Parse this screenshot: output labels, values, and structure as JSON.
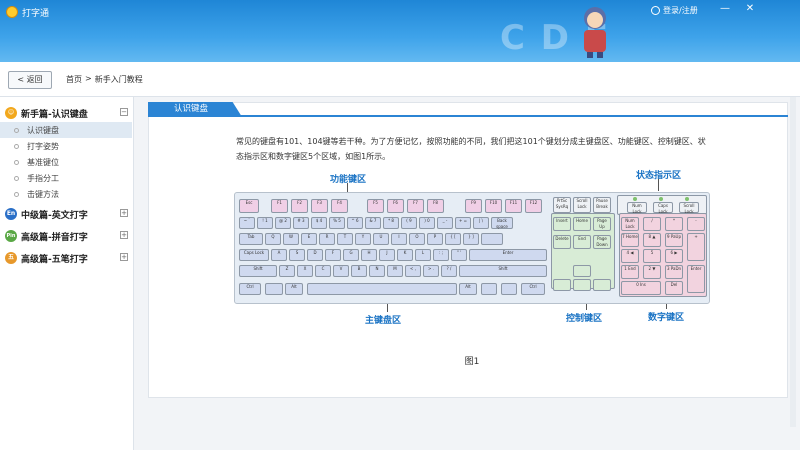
{
  "app": {
    "title": "打字通",
    "login": "登录/注册"
  },
  "window": {
    "minimize": "—",
    "close": "✕"
  },
  "nav": {
    "back": "< 返回",
    "breadcrumb": [
      "首页",
      ">",
      "新手入门教程"
    ]
  },
  "sidebar": {
    "groups": [
      {
        "label": "新手篇-认识键盘",
        "icon": "smiley-icon",
        "color": "#f2a81d",
        "toggle": "−",
        "items": [
          {
            "label": "认识键盘",
            "active": true
          },
          {
            "label": "打字姿势",
            "active": false
          },
          {
            "label": "基准键位",
            "active": false
          },
          {
            "label": "手指分工",
            "active": false
          },
          {
            "label": "击键方法",
            "active": false
          }
        ]
      },
      {
        "label": "中级篇-英文打字",
        "icon": "En",
        "color": "#2a6fc7",
        "toggle": "+"
      },
      {
        "label": "高级篇-拼音打字",
        "icon": "Pin",
        "color": "#5aa845",
        "toggle": "+"
      },
      {
        "label": "高级篇-五笔打字",
        "icon": "五",
        "color": "#e7982b",
        "toggle": "+"
      }
    ]
  },
  "content": {
    "tab_title": "认识键盘",
    "paragraph": "常见的键盘有101、104键等若干种。为了方便记忆，按照功能的不同，我们把这101个键划分成主键盘区、功能键区、控制键区、状态指示区和数字键区5个区域，如图1所示。",
    "callouts": {
      "function": "功能键区",
      "status": "状态指示区",
      "main": "主键盘区",
      "control": "控制键区",
      "numpad": "数字键区"
    },
    "figure_caption": "图1"
  },
  "keyboard": {
    "fn_row": [
      "Esc",
      "F1",
      "F2",
      "F3",
      "F4",
      "F5",
      "F6",
      "F7",
      "F8",
      "F9",
      "F10",
      "F11",
      "F12"
    ],
    "sys_row": [
      "PrtSc SysRq",
      "Scroll Lock",
      "Pause Break"
    ],
    "status_lights": [
      "Num Lock",
      "Caps Lock",
      "Scroll Lock"
    ],
    "num_row": [
      "~ `",
      "! 1",
      "@ 2",
      "# 3",
      "$ 4",
      "% 5",
      "^ 6",
      "& 7",
      "* 8",
      "( 9",
      ") 0",
      "_ -",
      "+ =",
      "| \\",
      "Back space"
    ],
    "tab_row": [
      "Tab",
      "Q",
      "W",
      "E",
      "R",
      "T",
      "Y",
      "U",
      "I",
      "O",
      "P",
      "{ [",
      "} ]"
    ],
    "caps_row": [
      "Caps Lock",
      "A",
      "S",
      "D",
      "F",
      "G",
      "H",
      "J",
      "K",
      "L",
      ": ;",
      "\" '",
      "Enter"
    ],
    "shift_row": [
      "Shift",
      "Z",
      "X",
      "C",
      "V",
      "B",
      "N",
      "M",
      "< ,",
      "> .",
      "? /",
      "Shift"
    ],
    "ctrl_row": [
      "Ctrl",
      "Alt",
      "Alt",
      "Ctrl"
    ],
    "nav_keys": [
      "Insert",
      "Home",
      "Page Up",
      "Delete",
      "End",
      "Page Down"
    ],
    "numpad": [
      "Num Lock",
      "/",
      "*",
      "-",
      "7 Home",
      "8 ▲",
      "9 PaUp",
      "+",
      "4 ◀",
      "5",
      "6 ▶",
      "1 End",
      "2 ▼",
      "3 PaDn",
      "Enter",
      "0 Ins",
      "Del"
    ]
  },
  "colors": {
    "accent": "#2b84d4",
    "callout": "#1a73c4",
    "fn_keys": "#f0cfe6",
    "main_keys": "#cfd9ef",
    "ctrl_keys": "#d8ecd6",
    "num_keys": "#f2d3df"
  }
}
